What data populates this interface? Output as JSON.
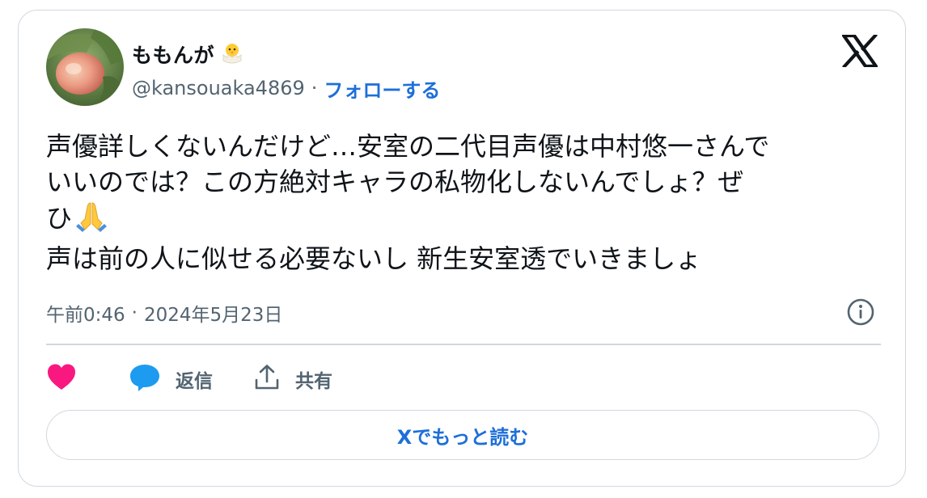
{
  "author": {
    "display_name": "ももんが",
    "badge_icon": "hatching-chick-icon",
    "handle": "@kansouaka4869",
    "separator": "·",
    "follow_label": "フォローする",
    "avatar_icon": "peach-avatar"
  },
  "brand": {
    "logo_icon": "x-logo-icon"
  },
  "tweet": {
    "lines": [
      "声優詳しくないんだけど…安室の二代目声優は中村悠一さんで",
      "いいのでは？この方絶対キャラの私物化しないんでしょ？ぜ",
      "ひ",
      "声は前の人に似せる必要ないし 新生安室透でいきましょ"
    ],
    "emoji_icon": "folded-hands-icon"
  },
  "timestamp": {
    "time": "午前0:46",
    "separator": "·",
    "date": "2024年5月23日"
  },
  "actions": {
    "like_icon": "heart-icon",
    "reply_label": "返信",
    "share_label": "共有"
  },
  "read_more_label": "Xでもっと読む",
  "colors": {
    "link": "#1d6fd8",
    "secondary_text": "#536471",
    "border": "#cfd9de",
    "like": "#f91880",
    "reply_icon": "#1d9bf0"
  }
}
